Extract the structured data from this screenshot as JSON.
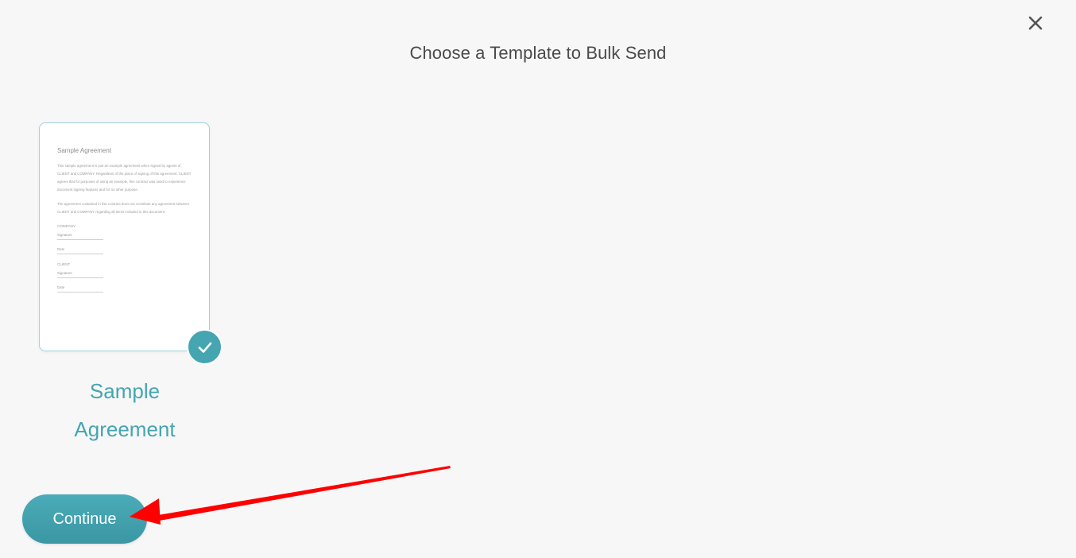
{
  "dialog": {
    "title": "Choose a Template to Bulk Send",
    "close_icon": "close-icon"
  },
  "templates": [
    {
      "name": "Sample Agreement",
      "selected": true,
      "preview": {
        "title": "Sample Agreement",
        "paragraph1": "This sample agreement is just an example agreement when signed by agents of CLIENT and COMPANY. Regardless of the place of signing of this agreement, CLIENT agrees that for purposes of using an example, this contract was used to experience document signing features and for no other purpose.",
        "paragraph2": "The agreement contained in this contract does not constitute any agreement between CLIENT and COMPANY regarding all items included in this document.",
        "company_label": "COMPANY",
        "client_label": "CLIENT",
        "signature_label": "Signature",
        "date_label": "Date"
      }
    }
  ],
  "actions": {
    "continue_label": "Continue"
  },
  "colors": {
    "accent": "#45a5b1",
    "annotation_arrow": "#ff0000",
    "background": "#f7f7f7"
  }
}
